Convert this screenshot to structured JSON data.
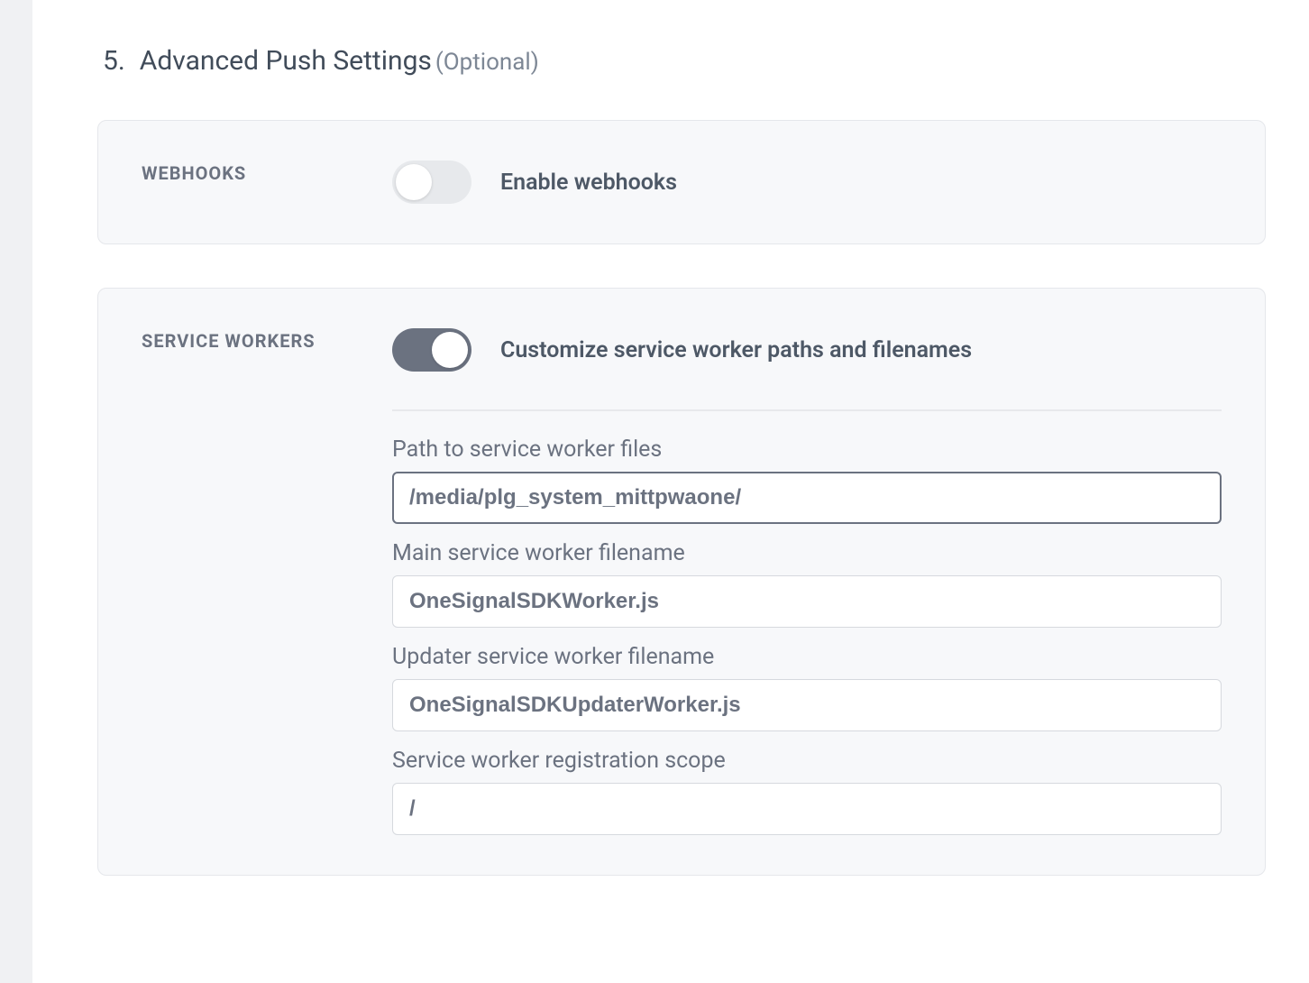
{
  "section": {
    "number": "5.",
    "title": "Advanced Push Settings",
    "optional": "(Optional)"
  },
  "webhooks": {
    "label": "WEBHOOKS",
    "toggle_label": "Enable webhooks",
    "enabled": false
  },
  "service_workers": {
    "label": "SERVICE WORKERS",
    "toggle_label": "Customize service worker paths and filenames",
    "enabled": true,
    "fields": {
      "path_label": "Path to service worker files",
      "path_value": "/media/plg_system_mittpwaone/",
      "main_label": "Main service worker filename",
      "main_value": "OneSignalSDKWorker.js",
      "updater_label": "Updater service worker filename",
      "updater_value": "OneSignalSDKUpdaterWorker.js",
      "scope_label": "Service worker registration scope",
      "scope_value": "/"
    }
  }
}
